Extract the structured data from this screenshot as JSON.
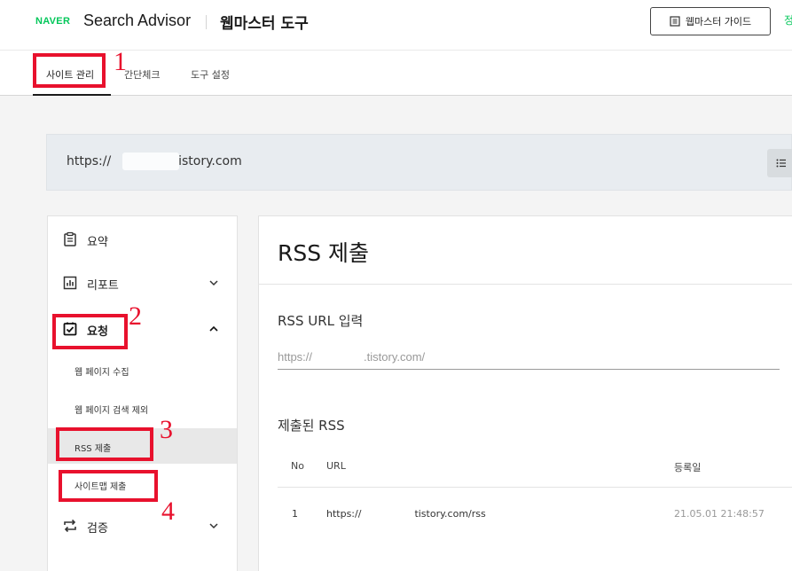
{
  "header": {
    "brand": "NAVER",
    "product": "Search Advisor",
    "tool": "웹마스터 도구",
    "guide_label": "웹마스터 가이드",
    "edge_text": "정"
  },
  "nav": {
    "items": [
      "사이트 관리",
      "간단체크",
      "도구 설정"
    ]
  },
  "site": {
    "url_prefix": "https://",
    "url_suffix": ".tistory.com"
  },
  "sidebar": {
    "summary": "요약",
    "report": "리포트",
    "request": "요청",
    "sub_items": [
      "웹 페이지 수집",
      "웹 페이지 검색 제외",
      "RSS 제출",
      "사이트맵 제출"
    ],
    "verify": "검증"
  },
  "main": {
    "title": "RSS 제출",
    "input_label": "RSS URL 입력",
    "input_placeholder_prefix": "https://",
    "input_placeholder_suffix": ".tistory.com/",
    "submitted_label": "제출된 RSS",
    "table": {
      "headers": [
        "No",
        "URL",
        "등록일"
      ],
      "rows": [
        {
          "no": "1",
          "url_prefix": "https://",
          "url_suffix": "tistory.com/rss",
          "date": "21.05.01 21:48:57"
        }
      ]
    }
  },
  "annotations": [
    "1",
    "2",
    "3",
    "4"
  ],
  "colors": {
    "naver_green": "#03c75a",
    "annotation_red": "#e8112d"
  }
}
